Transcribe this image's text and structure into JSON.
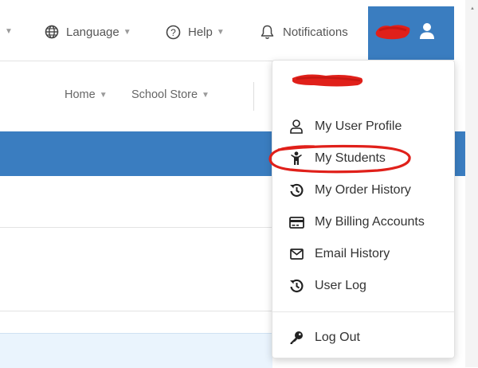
{
  "topbar": {
    "language_label": "Language",
    "help_label": "Help",
    "notifications_label": "Notifications"
  },
  "nav": {
    "home_label": "Home",
    "store_label": "School Store"
  },
  "user_menu": {
    "items": [
      {
        "label": "My User Profile",
        "icon": "user-icon"
      },
      {
        "label": "My Students",
        "icon": "child-icon"
      },
      {
        "label": "My Order History",
        "icon": "history-icon"
      },
      {
        "label": "My Billing Accounts",
        "icon": "credit-card-icon"
      },
      {
        "label": "Email History",
        "icon": "envelope-icon"
      },
      {
        "label": "User Log",
        "icon": "history-icon"
      }
    ],
    "logout_label": "Log Out",
    "logout_icon": "key-icon"
  },
  "colors": {
    "brand_blue": "#3a7dc0",
    "highlight_red": "#e0201a",
    "panel_light_blue": "#eaf4fd"
  }
}
